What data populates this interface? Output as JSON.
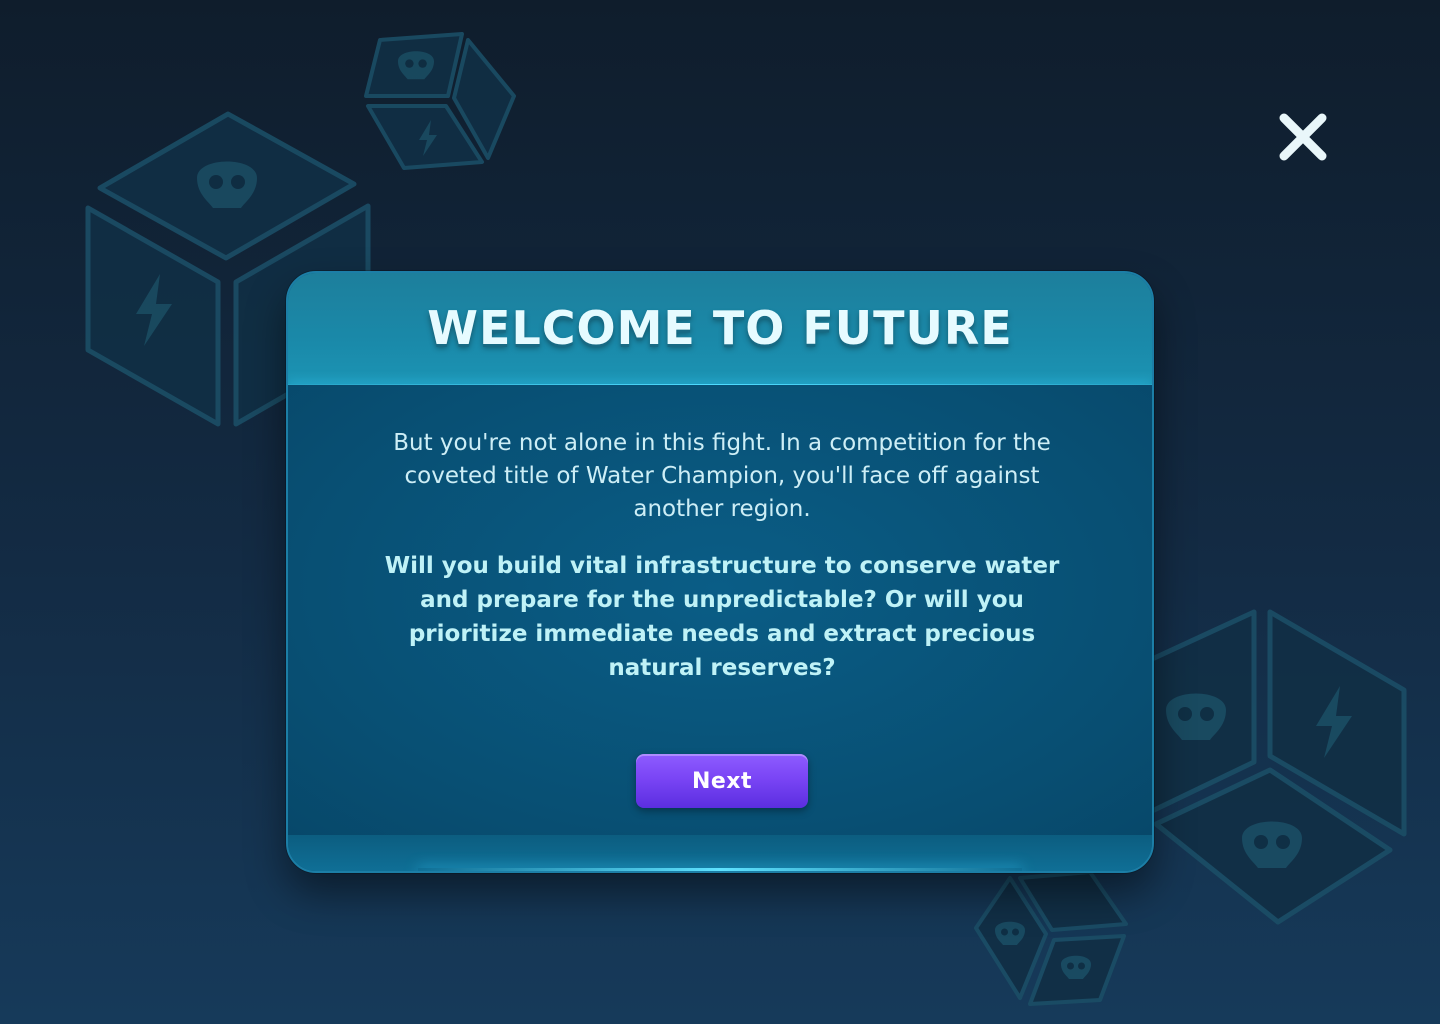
{
  "dialog": {
    "title": "WELCOME TO FUTURE",
    "intro": "But you're not alone in this fight. In a competition for the coveted title of Water Champion, you'll face off against another region.",
    "question": "Will you build vital infrastructure to conserve water and prepare for the unpredictable?  Or will you prioritize immediate needs and extract precious natural reserves?",
    "next_label": "Next"
  },
  "icons": {
    "close": "close-icon",
    "background": "dice-icon"
  },
  "colors": {
    "accent": "#7a45f5",
    "title": "#e6fbff",
    "panel": "#0b5478",
    "header": "#1a89a9"
  }
}
